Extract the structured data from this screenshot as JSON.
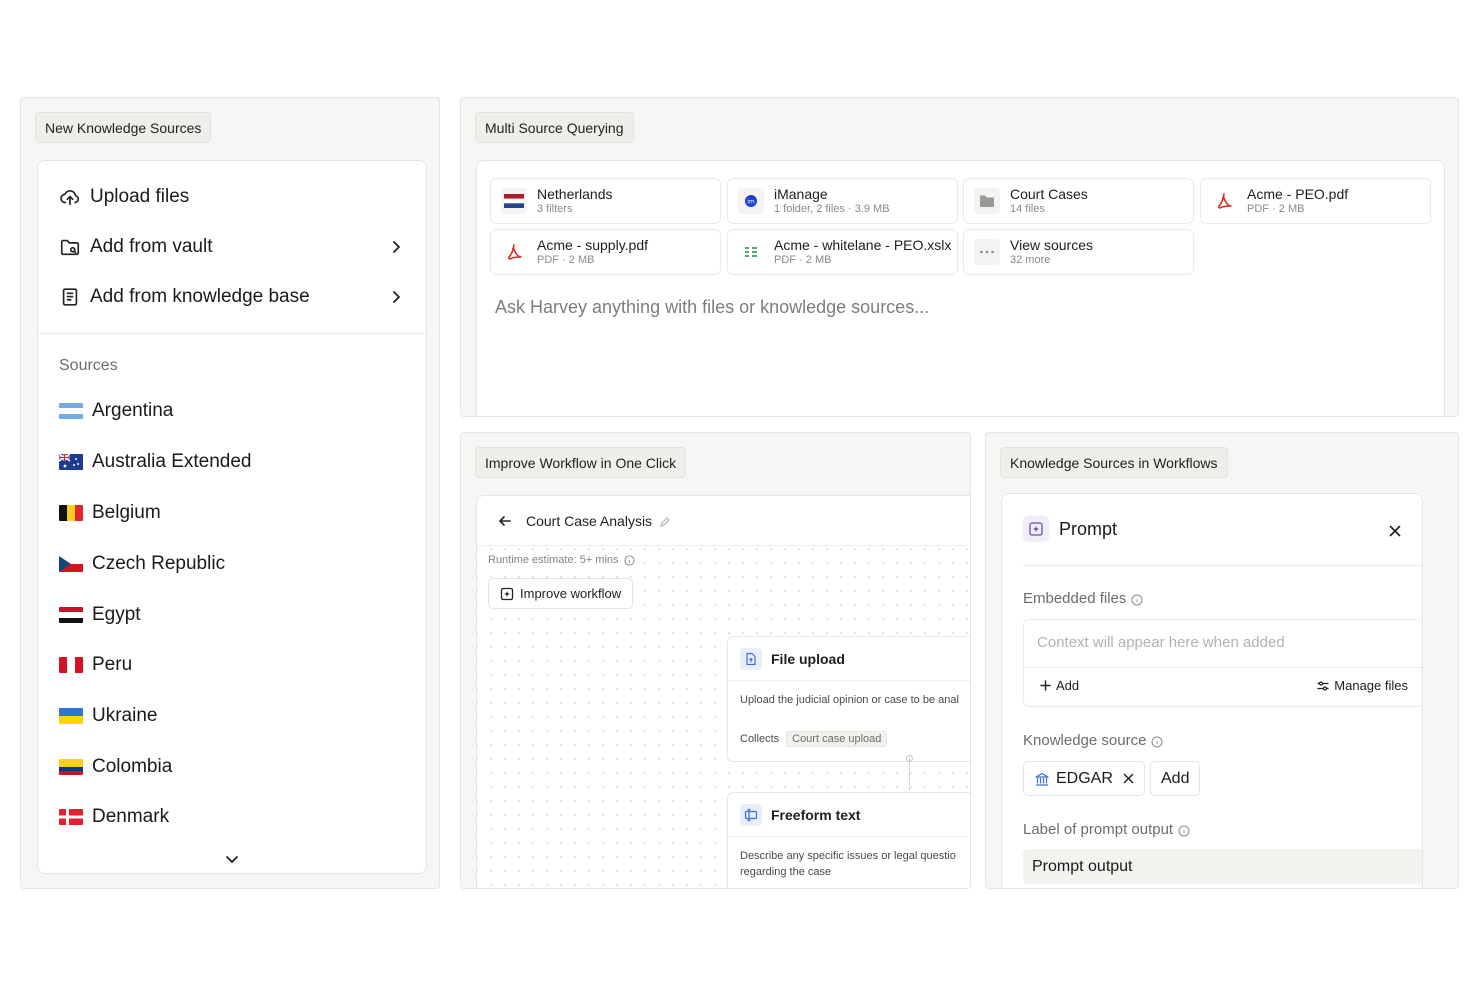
{
  "knowledge_panel": {
    "tag": "New Knowledge Sources",
    "actions": [
      {
        "label": "Upload files",
        "icon": "upload-cloud-icon"
      },
      {
        "label": "Add from vault",
        "icon": "folder-icon"
      },
      {
        "label": "Add from knowledge base",
        "icon": "book-icon"
      }
    ],
    "sources_label": "Sources",
    "countries": [
      {
        "name": "Argentina"
      },
      {
        "name": "Australia Extended"
      },
      {
        "name": "Belgium"
      },
      {
        "name": "Czech Republic"
      },
      {
        "name": "Egypt"
      },
      {
        "name": "Peru"
      },
      {
        "name": "Ukraine"
      },
      {
        "name": "Colombia"
      },
      {
        "name": "Denmark"
      }
    ]
  },
  "multi_source": {
    "tag": "Multi Source Querying",
    "chips": [
      {
        "name": "Netherlands",
        "meta": "3 filters",
        "icon": "netherlands-flag-icon"
      },
      {
        "name": "iManage",
        "meta": "1 folder, 2 files · 3.9 MB",
        "icon": "imanage-icon"
      },
      {
        "name": "Court Cases",
        "meta": "14 files",
        "icon": "folder-icon"
      },
      {
        "name": "Acme - PEO.pdf",
        "meta": "PDF · 2 MB",
        "icon": "pdf-icon"
      },
      {
        "name": "Acme - supply.pdf",
        "meta": "PDF · 2 MB",
        "icon": "pdf-icon"
      },
      {
        "name": "Acme - whitelane - PEO.xslx",
        "meta": "PDF · 2 MB",
        "icon": "spreadsheet-icon"
      },
      {
        "name": "View sources",
        "meta": "32 more",
        "icon": "more-dots-icon"
      }
    ],
    "placeholder": "Ask Harvey anything with files or knowledge sources..."
  },
  "workflow": {
    "tag": "Improve Workflow in One Click",
    "title": "Court Case Analysis",
    "runtime": "Runtime estimate: 5+ mins",
    "improve_label": "Improve workflow",
    "nodes": [
      {
        "title": "File upload",
        "desc": "Upload the judicial opinion or case to be anal",
        "collects_label": "Collects",
        "collects_value": "Court case upload"
      },
      {
        "title": "Freeform text",
        "desc": "Describe any specific issues or legal questio regarding the case"
      }
    ]
  },
  "ks_workflows": {
    "tag": "Knowledge Sources in Workflows",
    "title": "Prompt",
    "embedded_label": "Embedded files",
    "embedded_placeholder": "Context will appear here when added",
    "add_label": "Add",
    "manage_label": "Manage files",
    "ks_label": "Knowledge source",
    "ks_chip": "EDGAR",
    "ks_add": "Add",
    "output_label": "Label of prompt output",
    "output_value": "Prompt output"
  },
  "colors": {
    "panel_bg": "#f6f6f5",
    "border": "#e6e5e2",
    "muted_text": "#6d6c69",
    "pdf_red": "#d93025",
    "prompt_purple": "#6b4fa3"
  }
}
